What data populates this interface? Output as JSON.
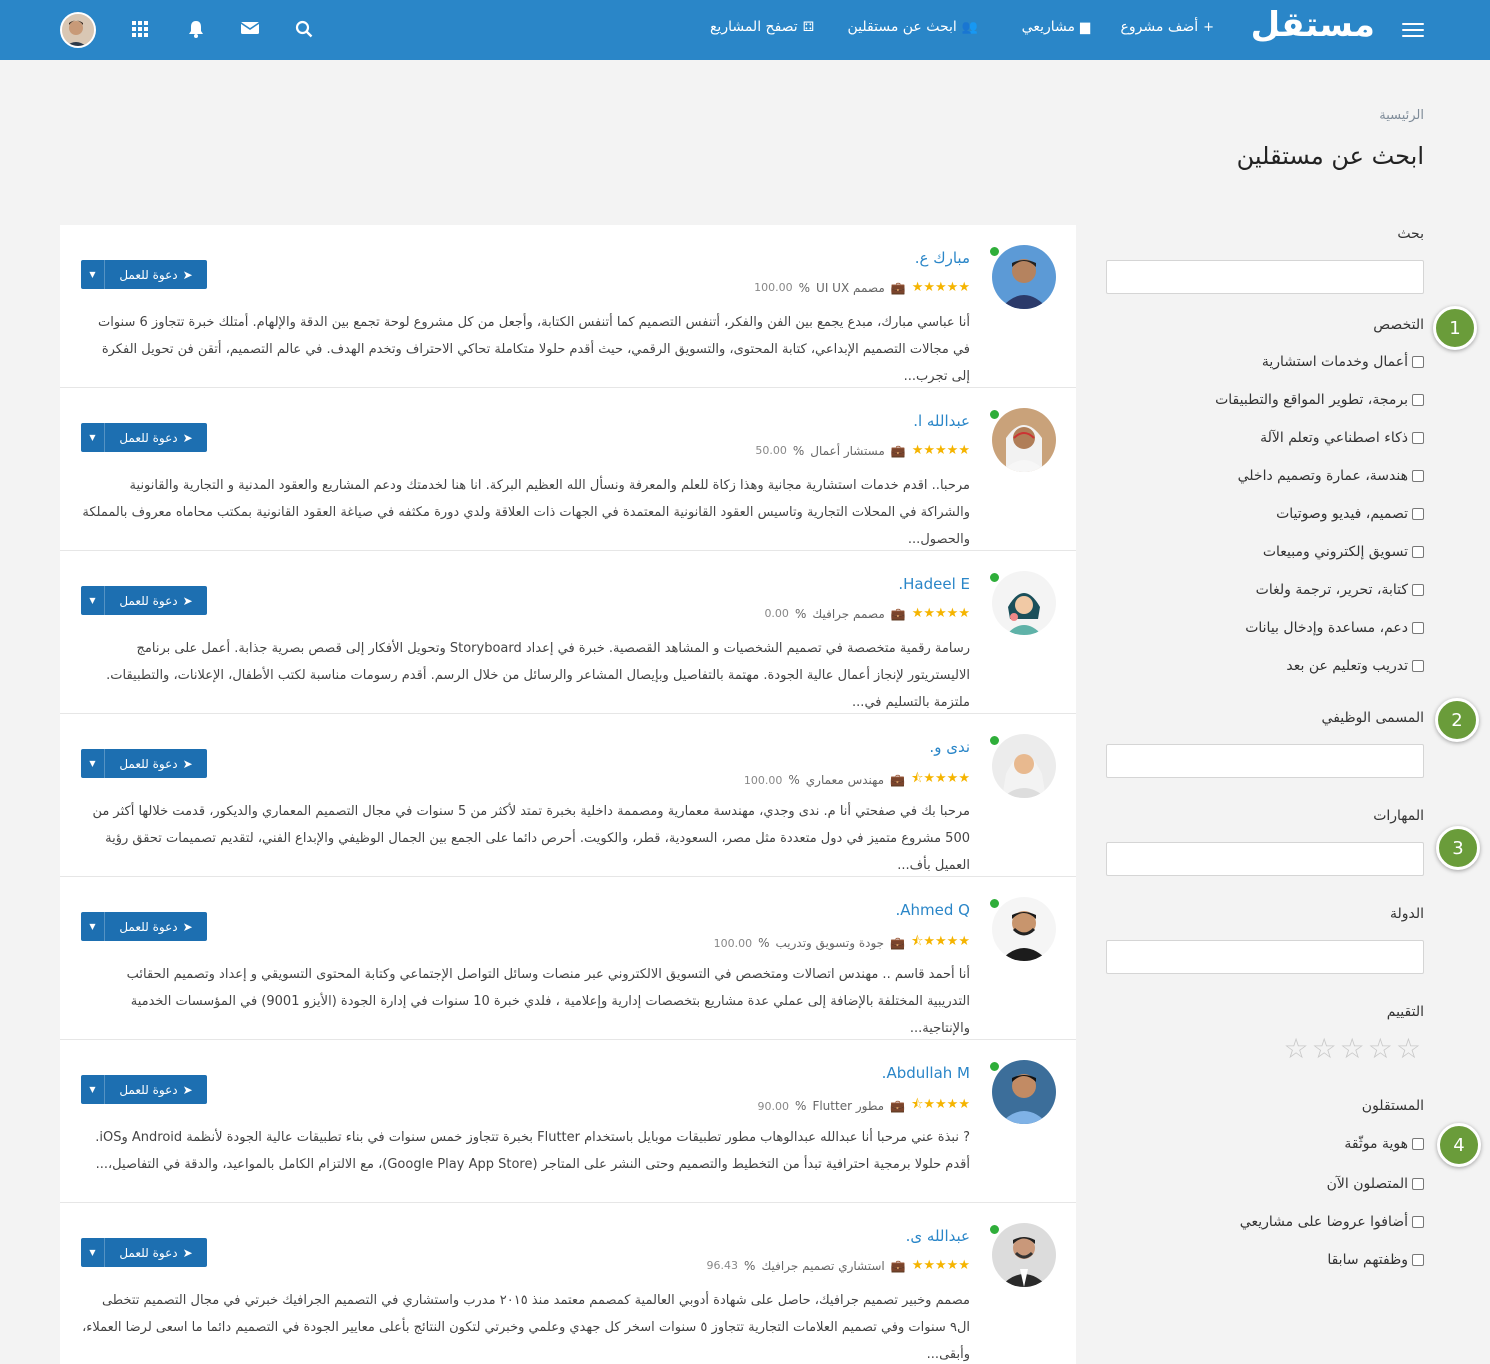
{
  "header": {
    "logo": "مستقل",
    "nav": {
      "add_project": "أضف مشروع",
      "my_projects": "مشاريعي",
      "find_freelancers": "ابحث عن مستقلين",
      "browse_projects": "تصفح المشاريع"
    }
  },
  "page": {
    "breadcrumb": "الرئيسية",
    "title": "ابحث عن مستقلين"
  },
  "sidebar": {
    "search_label": "بحث",
    "specialty_label": "التخصص",
    "specialties": [
      "أعمال وخدمات استشارية",
      "برمجة، تطوير المواقع والتطبيقات",
      "ذكاء اصطناعي وتعلم الآلة",
      "هندسة، عمارة وتصميم داخلي",
      "تصميم، فيديو وصوتيات",
      "تسويق إلكتروني ومبيعات",
      "كتابة، تحرير، ترجمة ولغات",
      "دعم، مساعدة وإدخال بيانات",
      "تدريب وتعليم عن بعد"
    ],
    "job_title_label": "المسمى الوظيفي",
    "skills_label": "المهارات",
    "country_label": "الدولة",
    "rating_label": "التقييم",
    "freelancers_label": "المستقلون",
    "freelancer_filters": [
      "هوية موثّقة",
      "المتصلون الآن",
      "أضافوا عروضا على مشاريعي",
      "وظفتهم سابقا"
    ],
    "badges": [
      "1",
      "2",
      "3",
      "4"
    ]
  },
  "invite_label": "دعوة للعمل",
  "freelancers": [
    {
      "name": "مبارك ع.",
      "title": "مصمم UI UX",
      "rating_pct": "100.00",
      "rating": 5,
      "desc": "أنا عباسي مبارك، مبدع يجمع بين الفن والفكر، أتنفس التصميم كما أتنفس الكتابة، وأجعل من كل مشروع لوحة تجمع بين الدقة والإلهام. أمتلك خبرة تتجاوز 6 سنوات في مجالات التصميم الإبداعي، كتابة المحتوى، والتسويق الرقمي، حيث أقدم حلولا متكاملة تحاكي الاحتراف وتخدم الهدف. في عالم التصميم، أتقن فن تحويل الفكرة إلى تجرب..."
    },
    {
      "name": "عبدالله ا.",
      "title": "مستشار أعمال",
      "rating_pct": "50.00",
      "rating": 5,
      "desc": "مرحبا.. اقدم خدمات استشارية مجانية وهذا زكاة للعلم والمعرفة ونسأل الله العظيم البركة. انا هنا لخدمتك ودعم المشاريع والعقود المدنية و التجارية والقانونية والشراكة في المحلات التجارية وتاسيس العقود القانونية المعتمدة في الجهات ذات العلاقة ولدي دورة مكثفه في صياغة العقود القانونية بمكتب محاماه معروف بالمملكة والحصول..."
    },
    {
      "name": "Hadeel E.",
      "title": "مصمم جرافيك",
      "rating_pct": "0.00",
      "rating": 5,
      "desc": "رسامة رقمية متخصصة في تصميم الشخصيات و المشاهد القصصية. خبرة في إعداد Storyboard وتحويل الأفكار إلى قصص بصرية جذابة. أعمل على برنامج الاليستريتور لإنجاز أعمال عالية الجودة. مهتمة بالتفاصيل وبإيصال المشاعر والرسائل من خلال الرسم. أقدم رسومات مناسبة لكتب الأطفال، الإعلانات، والتطبيقات. ملتزمة بالتسليم في..."
    },
    {
      "name": "ندى و.",
      "title": "مهندس معماري",
      "rating_pct": "100.00",
      "rating": 4.5,
      "desc": "مرحبا بك في صفحتي أنا م. ندى وجدي، مهندسة معمارية ومصممة داخلية بخبرة تمتد لأكثر من 5 سنوات في مجال التصميم المعماري والديكور، قدمت خلالها أكثر من 500 مشروع متميز في دول متعددة مثل مصر، السعودية، قطر، والكويت. أحرص دائما على الجمع بين الجمال الوظيفي والإبداع الفني، لتقديم تصميمات تحقق رؤية العميل بأف..."
    },
    {
      "name": "Ahmed Q.",
      "title": "جودة وتسويق وتدريب",
      "rating_pct": "100.00",
      "rating": 4.5,
      "desc": "أنا أحمد قاسم .. مهندس اتصالات ومتخصص في التسويق الالكتروني عبر منصات وسائل التواصل الإجتماعي وكتابة المحتوى التسويقي و إعداد وتصميم الحقائب التدريبية المختلفة بالإضافة إلى عملي عدة مشاريع بتخصصات إدارية وإعلامية ، فلدي خبرة 10 سنوات في إدارة الجودة (الأيزو 9001) في المؤسسات الخدمية والإنتاجية..."
    },
    {
      "name": "Abdullah M.",
      "title": "مطور Flutter",
      "rating_pct": "90.00",
      "rating": 4.5,
      "desc": "? نبذة عني مرحبا أنا عبدالله عبدالوهاب مطور تطبيقات موبايل باستخدام Flutter بخبرة تتجاوز خمس سنوات في بناء تطبيقات عالية الجودة لأنظمة Android وiOS. أقدم حلولا برمجية احترافية تبدأ من التخطيط والتصميم وحتى النشر على المتاجر (Google Play App Store)، مع الالتزام الكامل بالمواعيد، والدقة في التفاصيل،..."
    },
    {
      "name": "عبدالله ى.",
      "title": "استشاري تصميم جرافيك",
      "rating_pct": "96.43",
      "rating": 5,
      "desc": "مصمم وخبير تصميم جرافيك، حاصل على شهادة أدوبي العالمية كمصمم معتمد منذ ٢٠١٥ مدرب واستشاري في التصميم الجرافيك خبرتي في مجال التصميم تتخطى ال٩ سنوات وفي تصميم العلامات التجارية تتجاوز ٥ سنوات اسخر كل جهدي وعلمي وخبرتي لتكون النتائج بأعلى معايير الجودة في التصميم دائما ما اسعى لرضا العملاء، وأبقى..."
    }
  ],
  "colors": {
    "primary": "#2a86c8",
    "button": "#1d6fb1",
    "badge": "#6a9c3a",
    "online": "#2fae3a",
    "star": "#f5b400"
  }
}
